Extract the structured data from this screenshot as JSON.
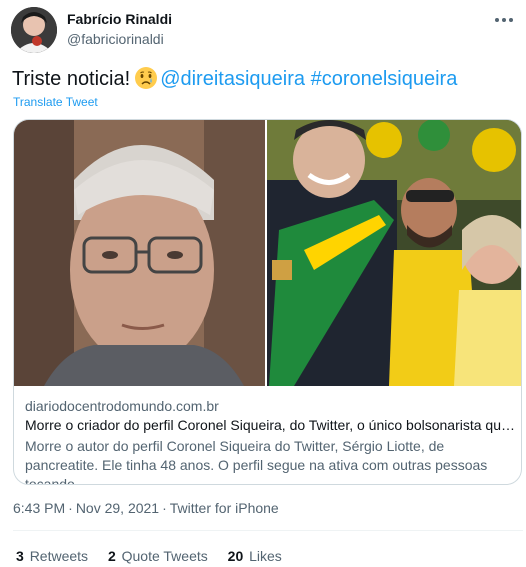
{
  "author": {
    "name": "Fabrício Rinaldi",
    "handle": "@fabriciorinaldi"
  },
  "tweet": {
    "text_lead": "Triste noticia!",
    "emoji": "crying-face",
    "mention": "@direitasiqueira",
    "hashtag": "#coronelsiqueira",
    "translate_label": "Translate Tweet"
  },
  "card": {
    "domain": "diariodocentrodomundo.com.br",
    "title": "Morre o criador do perfil Coronel Siqueira, do Twitter, o único bolsonarista que …",
    "description": "Morre o autor do perfil Coronel Siqueira do Twitter, Sérgio Liotte, de pancreatite. Ele tinha 48 anos. O perfil segue na ativa com outras pessoas tocando"
  },
  "meta": {
    "time": "6:43 PM",
    "separator": "·",
    "date": "Nov 29, 2021",
    "source": "Twitter for iPhone"
  },
  "stats": {
    "retweets_count": "3",
    "retweets_label": "Retweets",
    "quotes_count": "2",
    "quotes_label": "Quote Tweets",
    "likes_count": "20",
    "likes_label": "Likes"
  },
  "colors": {
    "link": "#1d9bf0",
    "text": "#0f1419",
    "secondary": "#536471",
    "border": "#cfd9de"
  }
}
